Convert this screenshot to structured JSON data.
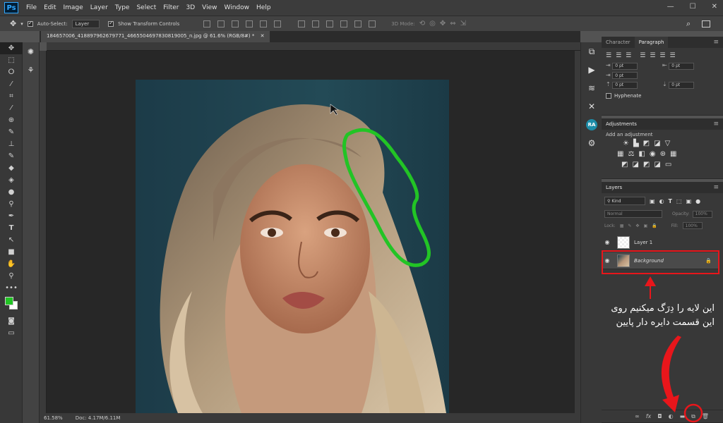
{
  "menubar": {
    "logo": "Ps",
    "items": [
      "File",
      "Edit",
      "Image",
      "Layer",
      "Type",
      "Select",
      "Filter",
      "3D",
      "View",
      "Window",
      "Help"
    ],
    "window_controls": [
      "—",
      "☐",
      "✕"
    ]
  },
  "options": {
    "auto_select_label": "Auto-Select:",
    "auto_select_value": "Layer",
    "show_transform_label": "Show Transform Controls",
    "mode_label": "3D Mode:"
  },
  "document": {
    "tab_title": "184657006_418897962679771_4665504697830819005_n.jpg @ 61.6% (RGB/8#) *",
    "zoom": "61.58%",
    "doc_size": "Doc: 4.17M/6.11M"
  },
  "character_panel": {
    "tabs": [
      "Character",
      "Paragraph"
    ],
    "fields": [
      "0 pt",
      "0 pt",
      "0 pt",
      "0 pt",
      "0 pt"
    ],
    "hyphenate_label": "Hyphenate"
  },
  "adjustments_panel": {
    "title": "Adjustments",
    "subtitle": "Add an adjustment"
  },
  "layers_panel": {
    "title": "Layers",
    "kind_label": "Kind",
    "blend_mode": "Normal",
    "opacity_label": "Opacity:",
    "opacity_value": "100%",
    "lock_label": "Lock:",
    "fill_label": "Fill:",
    "fill_value": "100%",
    "layers": [
      {
        "name": "Layer 1"
      },
      {
        "name": "Background"
      }
    ]
  },
  "annotation": {
    "line1": "این لایه را دِرَگ میکنیم روی",
    "line2": "این قسمت دایره دار پایین"
  },
  "colors": {
    "annotation_red": "#e8161b",
    "brush_green": "#22c425"
  }
}
